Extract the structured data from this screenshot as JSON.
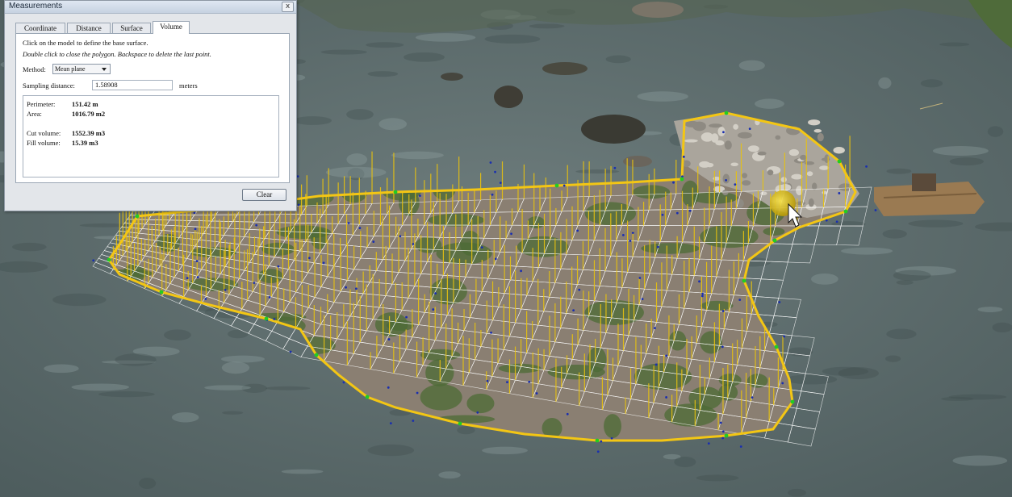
{
  "dialog": {
    "title": "Measurements",
    "close_label": "x",
    "tabs": [
      {
        "label": "Coordinate",
        "active": false
      },
      {
        "label": "Distance",
        "active": false
      },
      {
        "label": "Surface",
        "active": false
      },
      {
        "label": "Volume",
        "active": true
      }
    ],
    "instructions": {
      "line1": "Click on the model to define the base surface.",
      "line2": "Double click to close the polygon. Backspace to delete the last point."
    },
    "method": {
      "label": "Method:",
      "value": "Mean plane"
    },
    "sampling": {
      "label": "Sampling distance:",
      "value": "1.58908",
      "unit": "meters"
    },
    "results": {
      "perimeter_label": "Perimeter:",
      "perimeter_value": "151.42 m",
      "area_label": "Area:",
      "area_value": "1016.79 m2",
      "cut_label": "Cut volume:",
      "cut_value": "1552.39 m3",
      "fill_label": "Fill volume:",
      "fill_value": "15.39 m3"
    },
    "clear_label": "Clear"
  },
  "scene": {
    "water_color": "#5e6d6f",
    "polygon_color": "#f3c614",
    "grid_color": "#ffffff",
    "sample_line_color": "#e8c20f",
    "vertex_color": "#22cc22",
    "point_color": "#1a2fb0",
    "land_color": "#8a7f72",
    "vegetation_color": "#4c6b35",
    "cursor": "mouse-pointer-icon"
  }
}
